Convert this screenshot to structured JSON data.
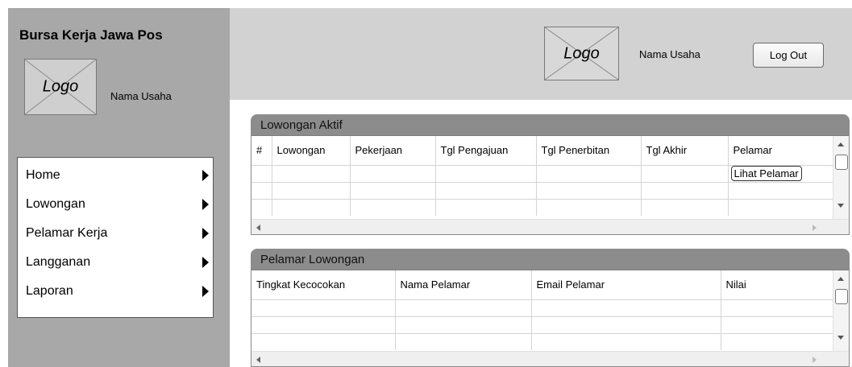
{
  "sidebar": {
    "title": "Bursa Kerja Jawa Pos",
    "logo_text": "Logo",
    "business_name": "Nama Usaha",
    "menu": [
      {
        "label": "Home",
        "icon": "arrow-right-icon"
      },
      {
        "label": "Lowongan",
        "icon": "arrow-right-icon"
      },
      {
        "label": "Pelamar Kerja",
        "icon": "arrow-right-icon"
      },
      {
        "label": "Langganan",
        "icon": "arrow-right-icon"
      },
      {
        "label": "Laporan",
        "icon": "arrow-right-icon"
      }
    ]
  },
  "header": {
    "logo_text": "Logo",
    "business_name": "Nama Usaha",
    "logout_label": "Log Out"
  },
  "active_jobs": {
    "title": "Lowongan Aktif",
    "columns": [
      "#",
      "Lowongan",
      "Pekerjaan",
      "Tgl Pengajuan",
      "Tgl Penerbitan",
      "Tgl Akhir",
      "Pelamar"
    ],
    "rows": [
      {
        "action_label": "Lihat Pelamar"
      },
      {},
      {}
    ]
  },
  "applicants": {
    "title": "Pelamar Lowongan",
    "columns": [
      "Tingkat Kecocokan",
      "Nama Pelamar",
      "Email Pelamar",
      "Nilai"
    ],
    "rows": [
      {},
      {},
      {}
    ]
  },
  "colors": {
    "sidebar_bg": "#a8a8a8",
    "header_bg": "#d2d2d2",
    "panel_header_bg": "#8c8c8c",
    "logo_placeholder_bg": "#cfcfcf"
  }
}
